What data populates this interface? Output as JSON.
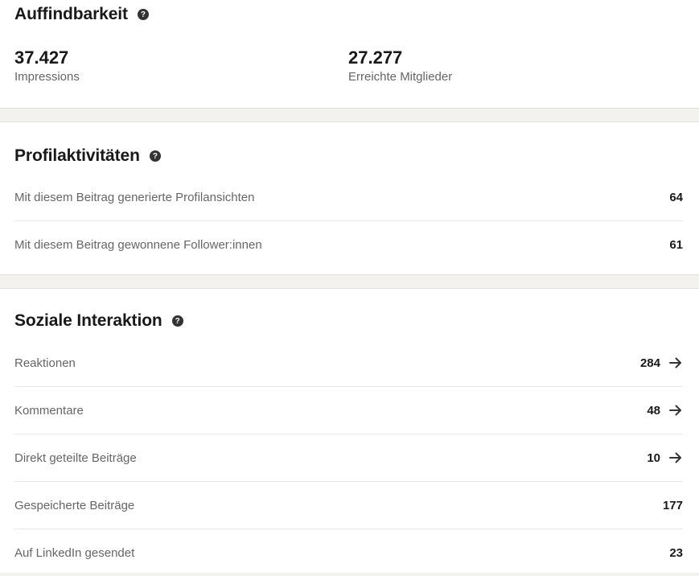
{
  "discoverability": {
    "title": "Auffindbarkeit",
    "help_icon": "question-circle-icon",
    "metrics": [
      {
        "value": "37.427",
        "label": "Impressions"
      },
      {
        "value": "27.277",
        "label": "Erreichte Mitglieder"
      }
    ]
  },
  "profile_activity": {
    "title": "Profilaktivitäten",
    "help_icon": "question-circle-icon",
    "rows": [
      {
        "label": "Mit diesem Beitrag generierte Profilansichten",
        "value": "64"
      },
      {
        "label": "Mit diesem Beitrag gewonnene Follower:innen",
        "value": "61"
      }
    ]
  },
  "social_engagement": {
    "title": "Soziale Interaktion",
    "help_icon": "question-circle-icon",
    "rows": [
      {
        "label": "Reaktionen",
        "value": "284",
        "has_arrow": true
      },
      {
        "label": "Kommentare",
        "value": "48",
        "has_arrow": true
      },
      {
        "label": "Direkt geteilte Beiträge",
        "value": "10",
        "has_arrow": true
      },
      {
        "label": "Gespeicherte Beiträge",
        "value": "177",
        "has_arrow": false
      },
      {
        "label": "Auf LinkedIn gesendet",
        "value": "23",
        "has_arrow": false
      }
    ]
  },
  "arrow_icon": "arrow-right-icon"
}
